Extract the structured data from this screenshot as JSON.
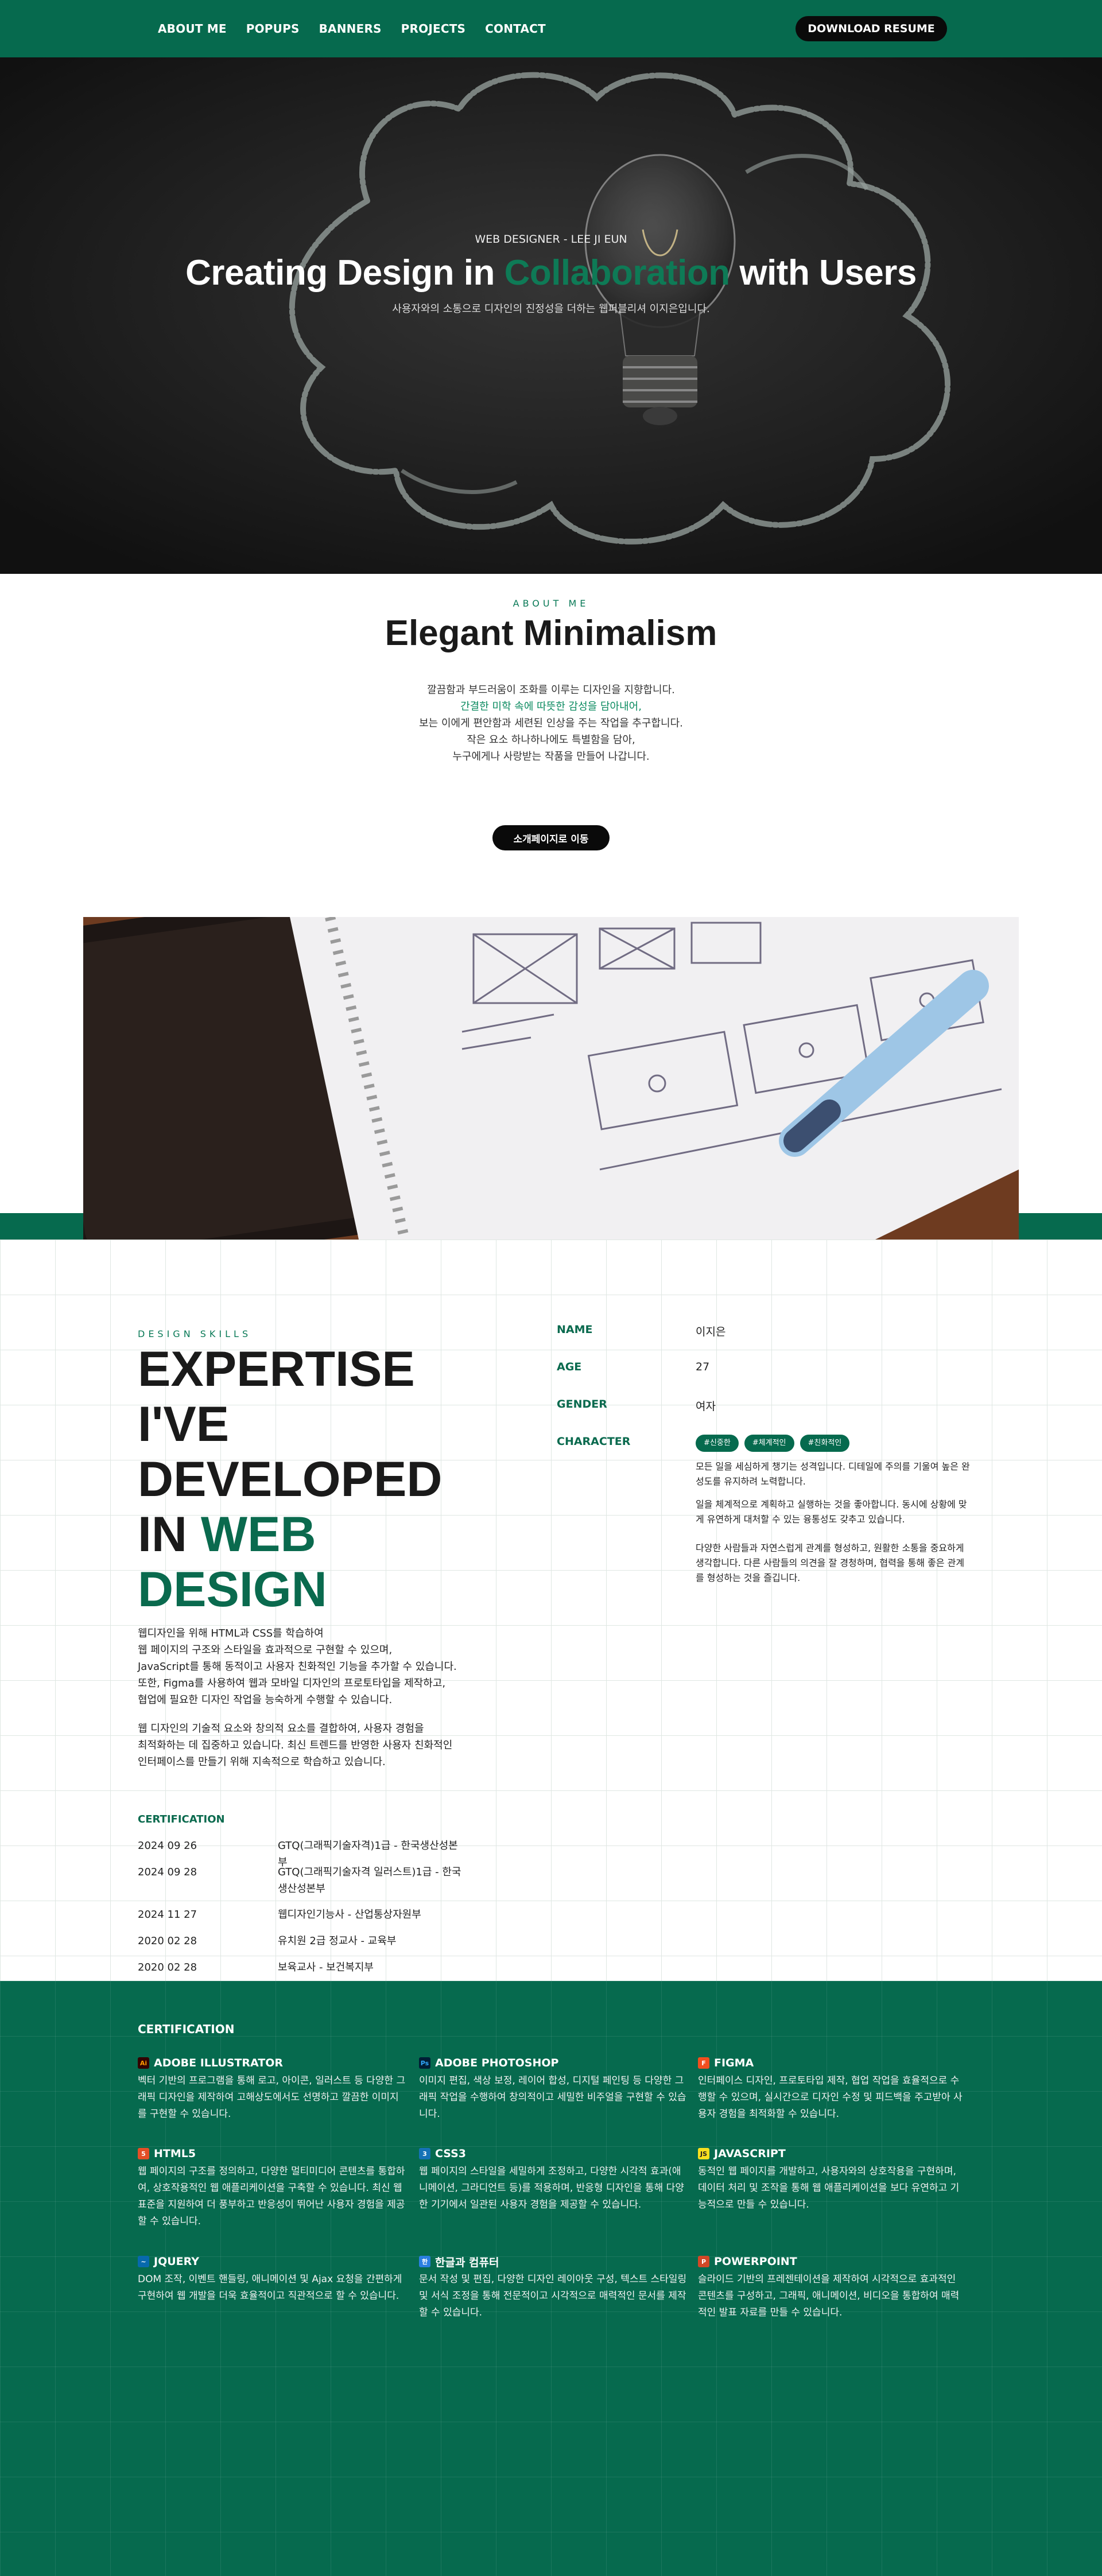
{
  "nav": {
    "links": [
      "ABOUT ME",
      "POPUPS",
      "BANNERS",
      "PROJECTS",
      "CONTACT"
    ],
    "cta": "DOWNLOAD RESUME"
  },
  "hero": {
    "subtitle": "WEB DESIGNER - LEE JI EUN",
    "title_before": "Creating Design in ",
    "title_accent": "Collaboration",
    "title_after": " with Users",
    "description": "사용자와의 소통으로 디자인의 진정성을 더하는  웹퍼블리셔 이지은입니다."
  },
  "about": {
    "eyebrow": "ABOUT ME",
    "title": "Elegant Minimalism",
    "lines": [
      "깔끔함과 부드러움이 조화를 이루는 디자인을 지향합니다.",
      "간결한 미학 속에 따뜻한 감성을 담아내어,",
      "보는 이에게 편안함과 세련된 인상을 주는 작업을 추구합니다.",
      "작은 요소 하나하나에도 특별함을 담아,",
      "누구에게나 사랑받는 작품을 만들어 나갑니다."
    ],
    "button": "소개페이지로 이동"
  },
  "skills": {
    "eyebrow": "DESIGN SKILLS",
    "title_line1": "EXPERTISE",
    "title_line2": "I'VE",
    "title_line3": "DEVELOPED",
    "title_line4_a": "IN ",
    "title_line4_b": "WEB",
    "title_line5": "DESIGN",
    "paragraph1": [
      "웹디자인을 위해 HTML과 CSS를 학습하여",
      "웹 페이지의 구조와 스타일을 효과적으로 구현할 수 있으며,",
      "JavaScript를 통해 동적이고 사용자 친화적인 기능을 추가할 수 있습니다.",
      "또한, Figma를 사용하여 웹과 모바일 디자인의 프로토타입을 제작하고,",
      "협업에 필요한 디자인 작업을 능숙하게 수행할 수 있습니다."
    ],
    "paragraph2": [
      "웹 디자인의 기술적 요소와 창의적 요소를 결합하여, 사용자 경험을",
      "최적화하는 데 집중하고 있습니다. 최신 트렌드를 반영한 사용자 친화적인",
      "인터페이스를 만들기 위해 지속적으로 학습하고 있습니다."
    ]
  },
  "certification": {
    "label": "CERTIFICATION",
    "rows": [
      {
        "date": "2024 09 26",
        "name": "GTQ(그래픽기술자격)1급 - 한국생산성본부"
      },
      {
        "date": "2024 09 28",
        "name": "GTQ(그래픽기술자격 일러스트)1급 - 한국생산성본부"
      },
      {
        "date": "2024 11 27",
        "name": "웹디자인기능사 - 산업통상자원부"
      },
      {
        "date": "2020 02 28",
        "name": "유치원 2급 정교사 - 교육부"
      },
      {
        "date": "2020 02 28",
        "name": "보육교사 - 보건복지부"
      }
    ]
  },
  "profile": {
    "name_label": "NAME",
    "name_value": "이지은",
    "age_label": "AGE",
    "age_value": "27",
    "gender_label": "GENDER",
    "gender_value": "여자",
    "character_label": "CHARACTER",
    "tags": [
      "#신중한",
      "#체계적인",
      "#친화적인"
    ],
    "character_paragraphs": [
      "모든 일을 세심하게 챙기는 성격입니다. 디테일에 주의를 기울여 높은 완성도를 유지하려 노력합니다.",
      "일을 체계적으로 계획하고 실행하는 것을 좋아합니다. 동시에 상황에 맞게 유연하게 대처할 수 있는 융통성도 갖추고 있습니다.",
      "다양한 사람들과 자연스럽게 관계를 형성하고, 원활한 소통을 중요하게 생각합니다. 다른 사람들의 의견을 잘 경청하며, 협력을 통해 좋은 관계를 형성하는 것을 즐깁니다."
    ]
  },
  "tools": {
    "title": "CERTIFICATION",
    "items": [
      {
        "name": "ADOBE ILLUSTRATOR",
        "icon": "Ai",
        "icon_name": "illustrator-icon",
        "icon_bg": "#330000",
        "icon_fg": "#ff9a00",
        "desc": "벡터 기반의 프로그램을 통해 로고, 아이콘, 일러스트 등 다양한 그래픽 디자인을 제작하여 고해상도에서도 선명하고 깔끔한 이미지를 구현할 수 있습니다."
      },
      {
        "name": "ADOBE PHOTOSHOP",
        "icon": "Ps",
        "icon_name": "photoshop-icon",
        "icon_bg": "#001e36",
        "icon_fg": "#31a8ff",
        "desc": "이미지 편집, 색상 보정, 레이어 합성, 디지털 페인팅 등 다양한 그래픽 작업을 수행하여 창의적이고 세밀한 비주얼을 구현할 수 있습니다."
      },
      {
        "name": "FIGMA",
        "icon": "F",
        "icon_name": "figma-icon",
        "icon_bg": "#f24e1e",
        "icon_fg": "#ffffff",
        "desc": "인터페이스 디자인, 프로토타입 제작, 협업 작업을 효율적으로 수행할 수 있으며, 실시간으로 디자인 수정 및 피드백을 주고받아 사용자 경험을 최적화할 수 있습니다."
      },
      {
        "name": "HTML5",
        "icon": "5",
        "icon_name": "html5-icon",
        "icon_bg": "#e34f26",
        "icon_fg": "#ffffff",
        "desc": "웹 페이지의 구조를 정의하고, 다양한 멀티미디어 콘텐츠를 통합하여, 상호작용적인 웹 애플리케이션을 구축할 수 있습니다. 최신 웹 표준을 지원하여 더 풍부하고 반응성이 뛰어난 사용자 경험을 제공할 수 있습니다."
      },
      {
        "name": "CSS3",
        "icon": "3",
        "icon_name": "css3-icon",
        "icon_bg": "#1572b6",
        "icon_fg": "#ffffff",
        "desc": "웹 페이지의 스타일을 세밀하게 조정하고, 다양한 시각적 효과(애니메이션, 그라디언트 등)를 적용하며, 반응형 디자인을 통해 다양한 기기에서 일관된 사용자 경험을 제공할 수 있습니다."
      },
      {
        "name": "JAVASCRIPT",
        "icon": "JS",
        "icon_name": "javascript-icon",
        "icon_bg": "#f7df1e",
        "icon_fg": "#222222",
        "desc": "동적인 웹 페이지를 개발하고, 사용자와의 상호작용을 구현하며, 데이터 처리 및 조작을 통해 웹 애플리케이션을 보다 유연하고 기능적으로 만들 수 있습니다."
      },
      {
        "name": "JQUERY",
        "icon": "~",
        "icon_name": "jquery-icon",
        "icon_bg": "#0769ad",
        "icon_fg": "#ffffff",
        "desc": " DOM 조작, 이벤트 핸들링, 애니메이션 및 Ajax 요청을 간편하게 구현하여 웹 개발을 더욱 효율적이고 직관적으로 할 수 있습니다."
      },
      {
        "name": "한글과 컴퓨터",
        "icon": "한",
        "icon_name": "hancom-icon",
        "icon_bg": "#2a7fe0",
        "icon_fg": "#ffffff",
        "desc": " 문서 작성 및 편집, 다양한 디자인 레이아웃 구성, 텍스트 스타일링 및 서식 조정을 통해 전문적이고 시각적으로 매력적인 문서를 제작할 수 있습니다."
      },
      {
        "name": "POWERPOINT",
        "icon": "P",
        "icon_name": "powerpoint-icon",
        "icon_bg": "#d24726",
        "icon_fg": "#ffffff",
        "desc": "슬라이드 기반의 프레젠테이션을 제작하여 시각적으로 효과적인 콘텐츠를 구성하고, 그래픽, 애니메이션, 비디오을 통합하여 매력적인 발표 자료를 만들 수 있습니다."
      }
    ]
  }
}
